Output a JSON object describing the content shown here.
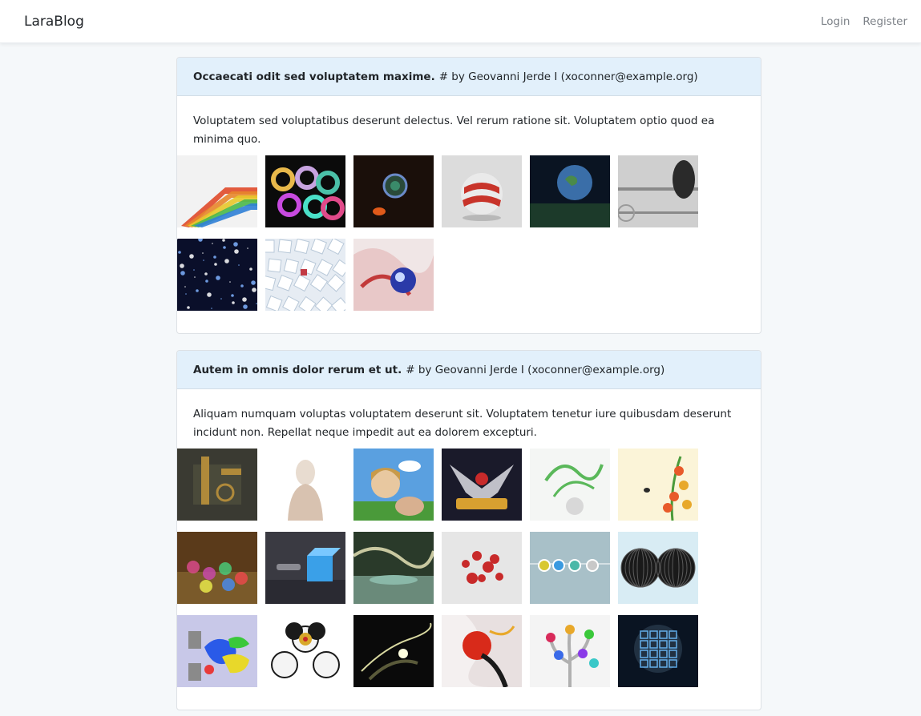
{
  "navbar": {
    "brand": "LaraBlog",
    "login": "Login",
    "register": "Register"
  },
  "posts": [
    {
      "title": "Occaecati odit sed voluptatem maxime.",
      "byline": "# by Geovanni Jerde I (xoconner@example.org)",
      "body": "Voluptatem sed voluptatibus deserunt delectus. Vel rerum ratione sit. Voluptatem optio quod ea minima quo.",
      "images": [
        {
          "name": "colorful-ribbon-image",
          "bg": "#f2f2f2",
          "fg": "#e8862b",
          "accent": "#2f7fd6",
          "kind": "ribbon"
        },
        {
          "name": "glass-swirls-image",
          "bg": "#0b0b0b",
          "fg": "#c7a3e0",
          "accent": "#4bc0a8",
          "kind": "swirls"
        },
        {
          "name": "dark-eye-image",
          "bg": "#1a0f0a",
          "fg": "#3a8a6a",
          "accent": "#e05a1a",
          "kind": "eye"
        },
        {
          "name": "striped-sphere-image",
          "bg": "#dcdcdc",
          "fg": "#c8342a",
          "accent": "#9a9a9a",
          "kind": "sphere"
        },
        {
          "name": "earth-planet-image",
          "bg": "#0a1422",
          "fg": "#3a6ea8",
          "accent": "#1c3a2a",
          "kind": "planet"
        },
        {
          "name": "chrome-head-image",
          "bg": "#cfcfcf",
          "fg": "#2a2a2a",
          "accent": "#8a8a8a",
          "kind": "head"
        },
        {
          "name": "blue-particles-image",
          "bg": "#0a0f2a",
          "fg": "#7fb2ff",
          "accent": "#ffffff",
          "kind": "particles"
        },
        {
          "name": "white-cubes-image",
          "bg": "#e6ecf3",
          "fg": "#ffffff",
          "accent": "#c23a44",
          "kind": "cubes"
        },
        {
          "name": "red-blue-orb-image",
          "bg": "#f0e6e6",
          "fg": "#c23a3a",
          "accent": "#2a3aa8",
          "kind": "orb"
        }
      ]
    },
    {
      "title": "Autem in omnis dolor rerum et ut.",
      "byline": "# by Geovanni Jerde I (xoconner@example.org)",
      "body": "Aliquam numquam voluptas voluptatem deserunt sit. Voluptatem tenetur iure quibusdam deserunt incidunt non. Repellat neque impedit aut ea dolorem excepturi.",
      "images": [
        {
          "name": "steampunk-machine-image",
          "bg": "#3a3a32",
          "fg": "#b08a3a",
          "accent": "#5a5a52",
          "kind": "machine"
        },
        {
          "name": "white-figure-image",
          "bg": "#ffffff",
          "fg": "#e8dcd0",
          "accent": "#d8c2b0",
          "kind": "figure"
        },
        {
          "name": "cartoon-girl-image",
          "bg": "#5aa0e0",
          "fg": "#e8c8a0",
          "accent": "#4a9a3a",
          "kind": "girl"
        },
        {
          "name": "airborne-logo-image",
          "bg": "#1a1a2a",
          "fg": "#c0c0c8",
          "accent": "#d8a030",
          "kind": "logo"
        },
        {
          "name": "green-splash-image",
          "bg": "#f4f6f4",
          "fg": "#5ab85a",
          "accent": "#d8d8d8",
          "kind": "splash"
        },
        {
          "name": "flowers-butterfly-image",
          "bg": "#fbf4d8",
          "fg": "#e85a2a",
          "accent": "#4a9a3a",
          "kind": "flowers"
        },
        {
          "name": "glass-marbles-image",
          "bg": "#5a3a1a",
          "fg": "#c84aa8",
          "accent": "#4ac878",
          "kind": "marbles"
        },
        {
          "name": "blue-cube-image",
          "bg": "#3a3a42",
          "fg": "#3aa0e8",
          "accent": "#8a8a92",
          "kind": "cube"
        },
        {
          "name": "fantasy-landscape-image",
          "bg": "#2a3a2a",
          "fg": "#c8c8a0",
          "accent": "#6a8a7a",
          "kind": "landscape"
        },
        {
          "name": "red-drops-image",
          "bg": "#e6e6e6",
          "fg": "#c82a2a",
          "accent": "#ffffff",
          "kind": "drops"
        },
        {
          "name": "color-orbs-image",
          "bg": "#a8c0c8",
          "fg": "#d8c830",
          "accent": "#3a9ae0",
          "kind": "orbs"
        },
        {
          "name": "black-spheres-image",
          "bg": "#d8ecf4",
          "fg": "#1a1a1a",
          "accent": "#5a5a5a",
          "kind": "spheres"
        },
        {
          "name": "paint-buckets-image",
          "bg": "#c8c8e8",
          "fg": "#2a5ae8",
          "accent": "#e8d82a",
          "kind": "paint"
        },
        {
          "name": "radiation-balls-image",
          "bg": "#ffffff",
          "fg": "#1a1a1a",
          "accent": "#d8a82a",
          "kind": "radiation"
        },
        {
          "name": "light-streaks-image",
          "bg": "#0a0a0a",
          "fg": "#d8d8a0",
          "accent": "#5a5a3a",
          "kind": "streaks"
        },
        {
          "name": "red-abstract-image",
          "bg": "#f4f0f0",
          "fg": "#d82a1a",
          "accent": "#1a1a1a",
          "kind": "abstract"
        },
        {
          "name": "color-tree-image",
          "bg": "#f4f4f4",
          "fg": "#b0b0b0",
          "accent": "#d82a5a",
          "kind": "tree"
        },
        {
          "name": "blue-crystal-image",
          "bg": "#0a1422",
          "fg": "#5aa8e8",
          "accent": "#a8d8ff",
          "kind": "crystal"
        }
      ]
    }
  ]
}
